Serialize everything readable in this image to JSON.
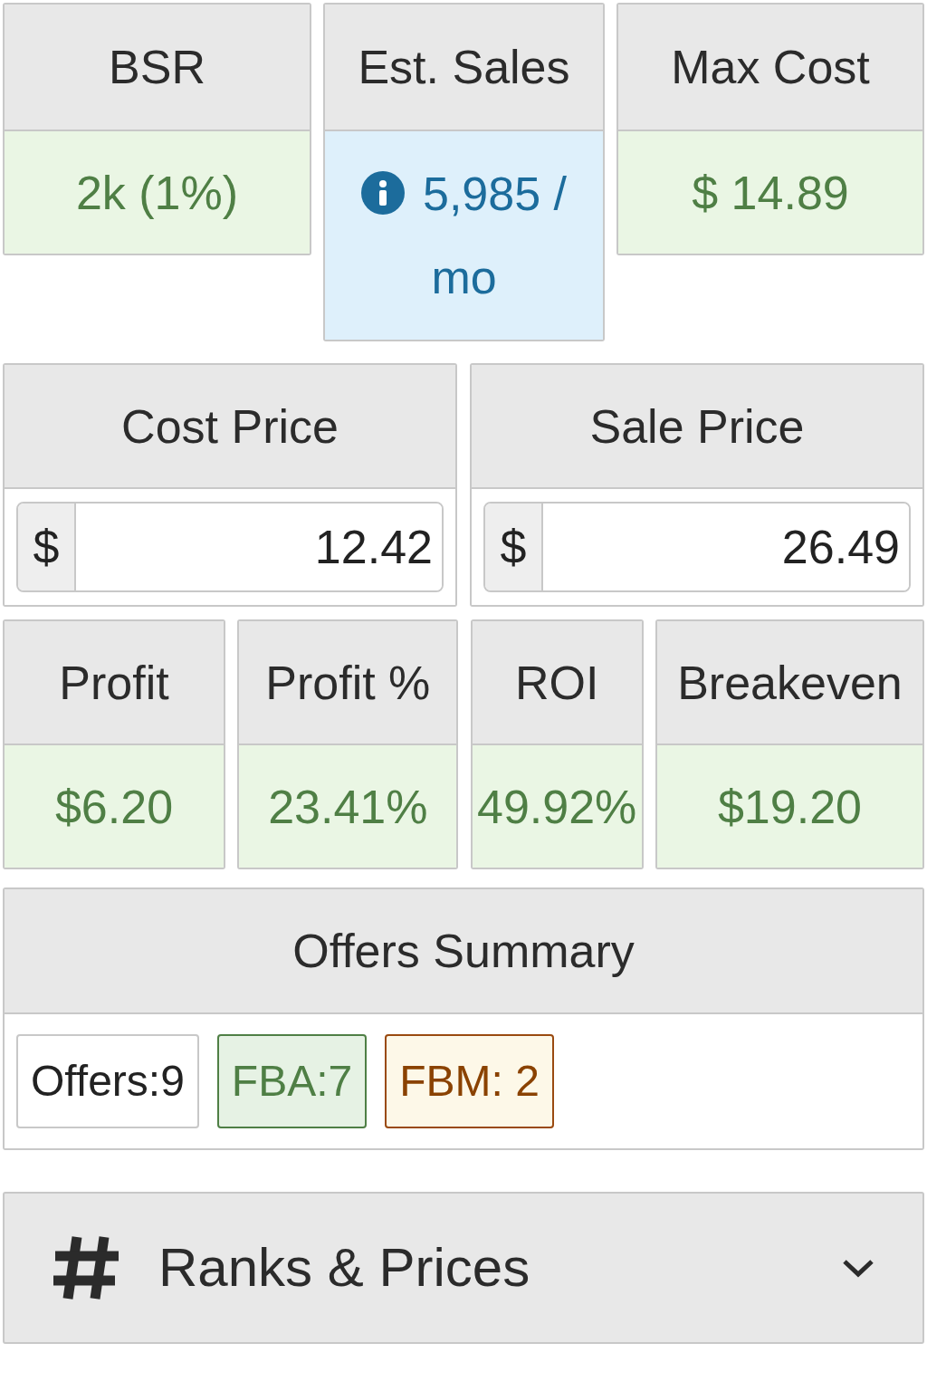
{
  "metrics_top": [
    {
      "label": "BSR",
      "value": "2k (1%)",
      "kind": "good"
    },
    {
      "label": "Est. Sales",
      "value": "5,985 / mo",
      "kind": "info"
    },
    {
      "label": "Max Cost",
      "value": "$ 14.89",
      "kind": "good"
    }
  ],
  "price_inputs": [
    {
      "label": "Cost Price",
      "prefix": "$",
      "value": "12.42"
    },
    {
      "label": "Sale Price",
      "prefix": "$",
      "value": "26.49"
    }
  ],
  "metrics_bottom": [
    {
      "label": "Profit",
      "value": "$6.20",
      "kind": "good"
    },
    {
      "label": "Profit %",
      "value": "23.41%",
      "kind": "good"
    },
    {
      "label": "ROI",
      "value": "49.92%",
      "kind": "good"
    },
    {
      "label": "Breakeven",
      "value": "$19.20",
      "kind": "good"
    }
  ],
  "offers_summary": {
    "title": "Offers Summary",
    "badges": [
      {
        "text": "Offers:9",
        "kind": "neutral"
      },
      {
        "text": "FBA:7",
        "kind": "fba"
      },
      {
        "text": "FBM: 2",
        "kind": "fbm"
      }
    ]
  },
  "section": {
    "title": "Ranks & Prices",
    "expanded": false
  }
}
